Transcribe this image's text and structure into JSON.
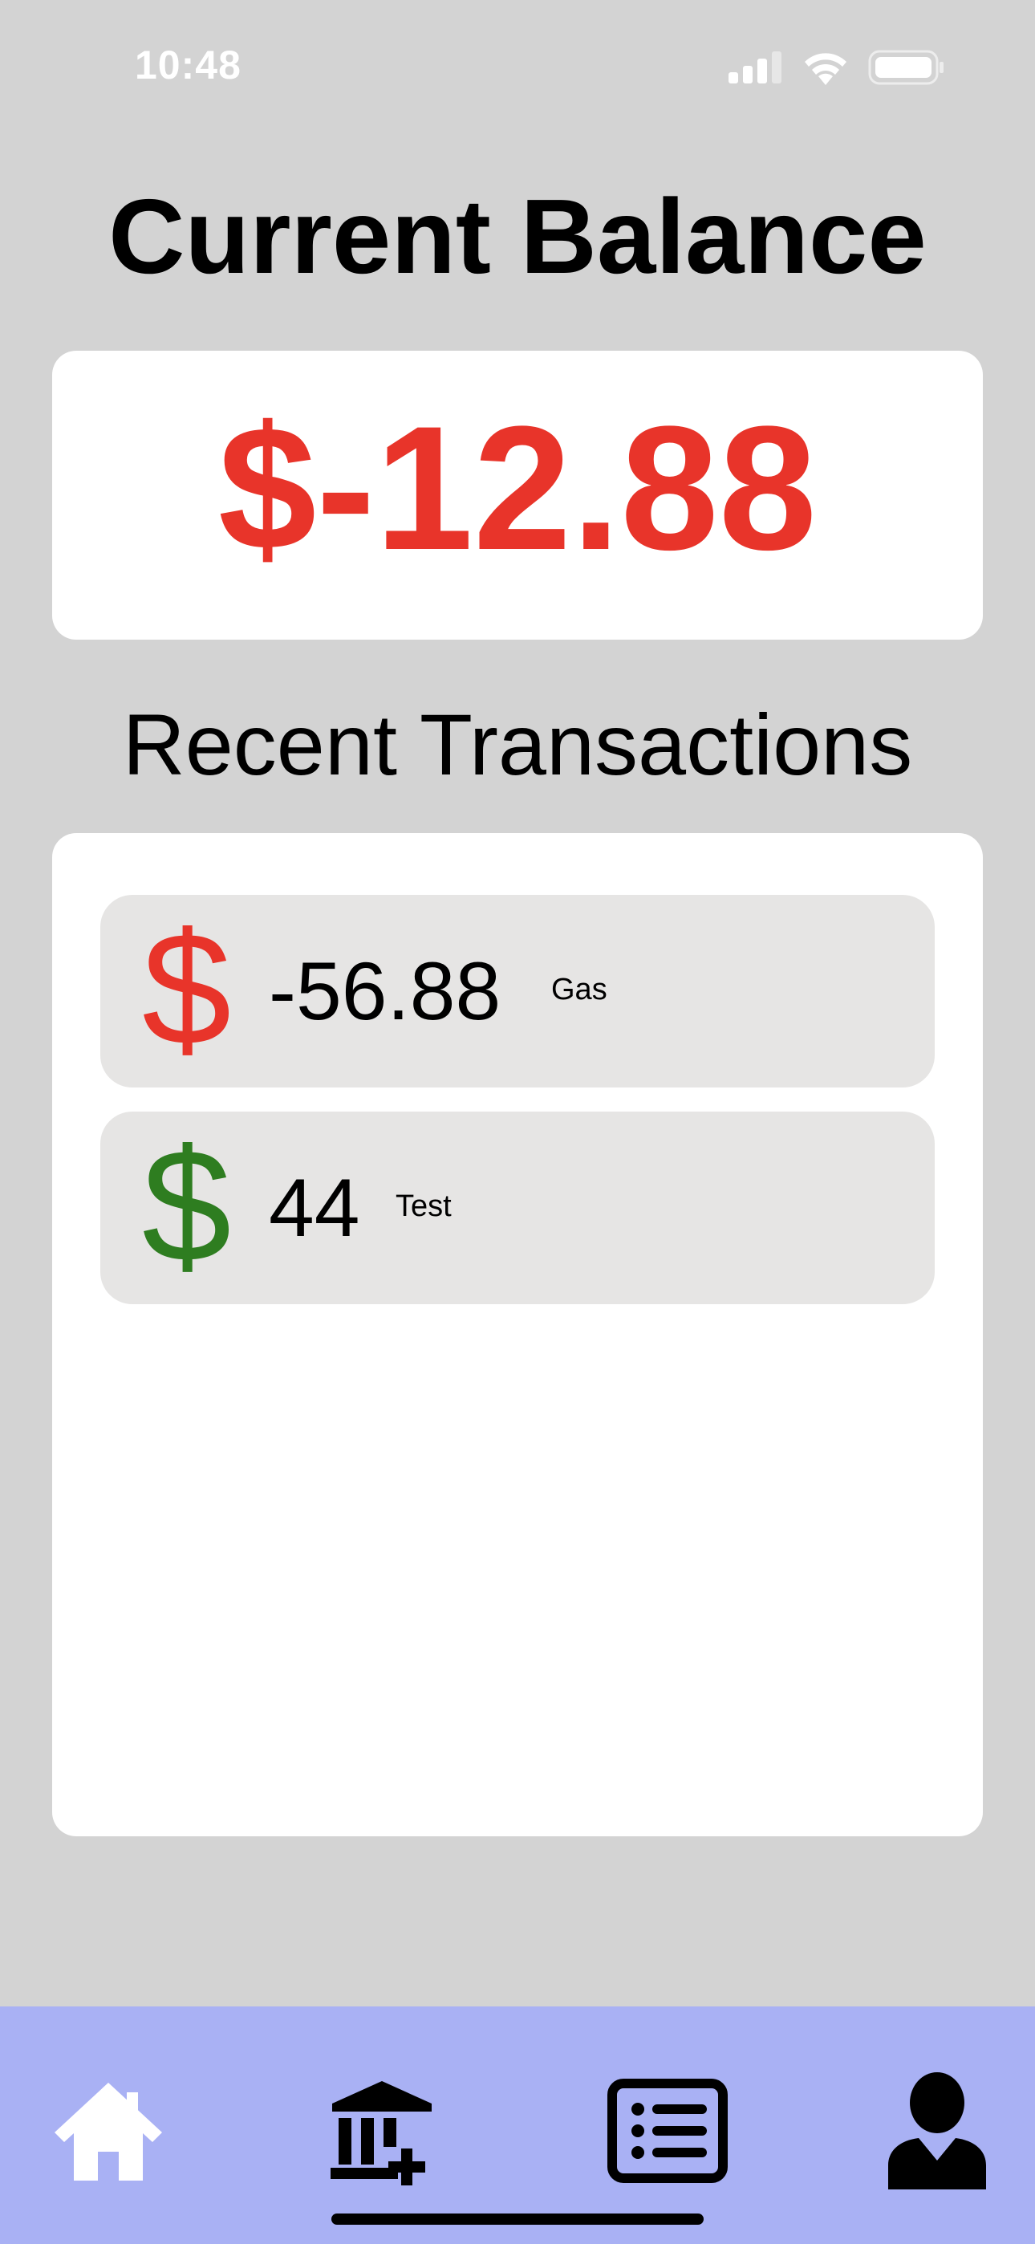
{
  "status_bar": {
    "time": "10:48"
  },
  "title": "Current Balance",
  "balance": {
    "value": "$-12.88",
    "color": "#e8342a"
  },
  "recent": {
    "title": "Recent Transactions",
    "transactions": [
      {
        "symbol": "$",
        "amount": "-56.88",
        "description": "Gas",
        "color": "#e8342a"
      },
      {
        "symbol": "$",
        "amount": "44",
        "description": "Test",
        "color": "#2e7d20"
      }
    ]
  },
  "tab_bar": {
    "background": "#a9b1f4",
    "tabs": [
      {
        "icon": "home-icon"
      },
      {
        "icon": "bank-add-icon"
      },
      {
        "icon": "list-icon"
      },
      {
        "icon": "person-icon"
      }
    ]
  }
}
